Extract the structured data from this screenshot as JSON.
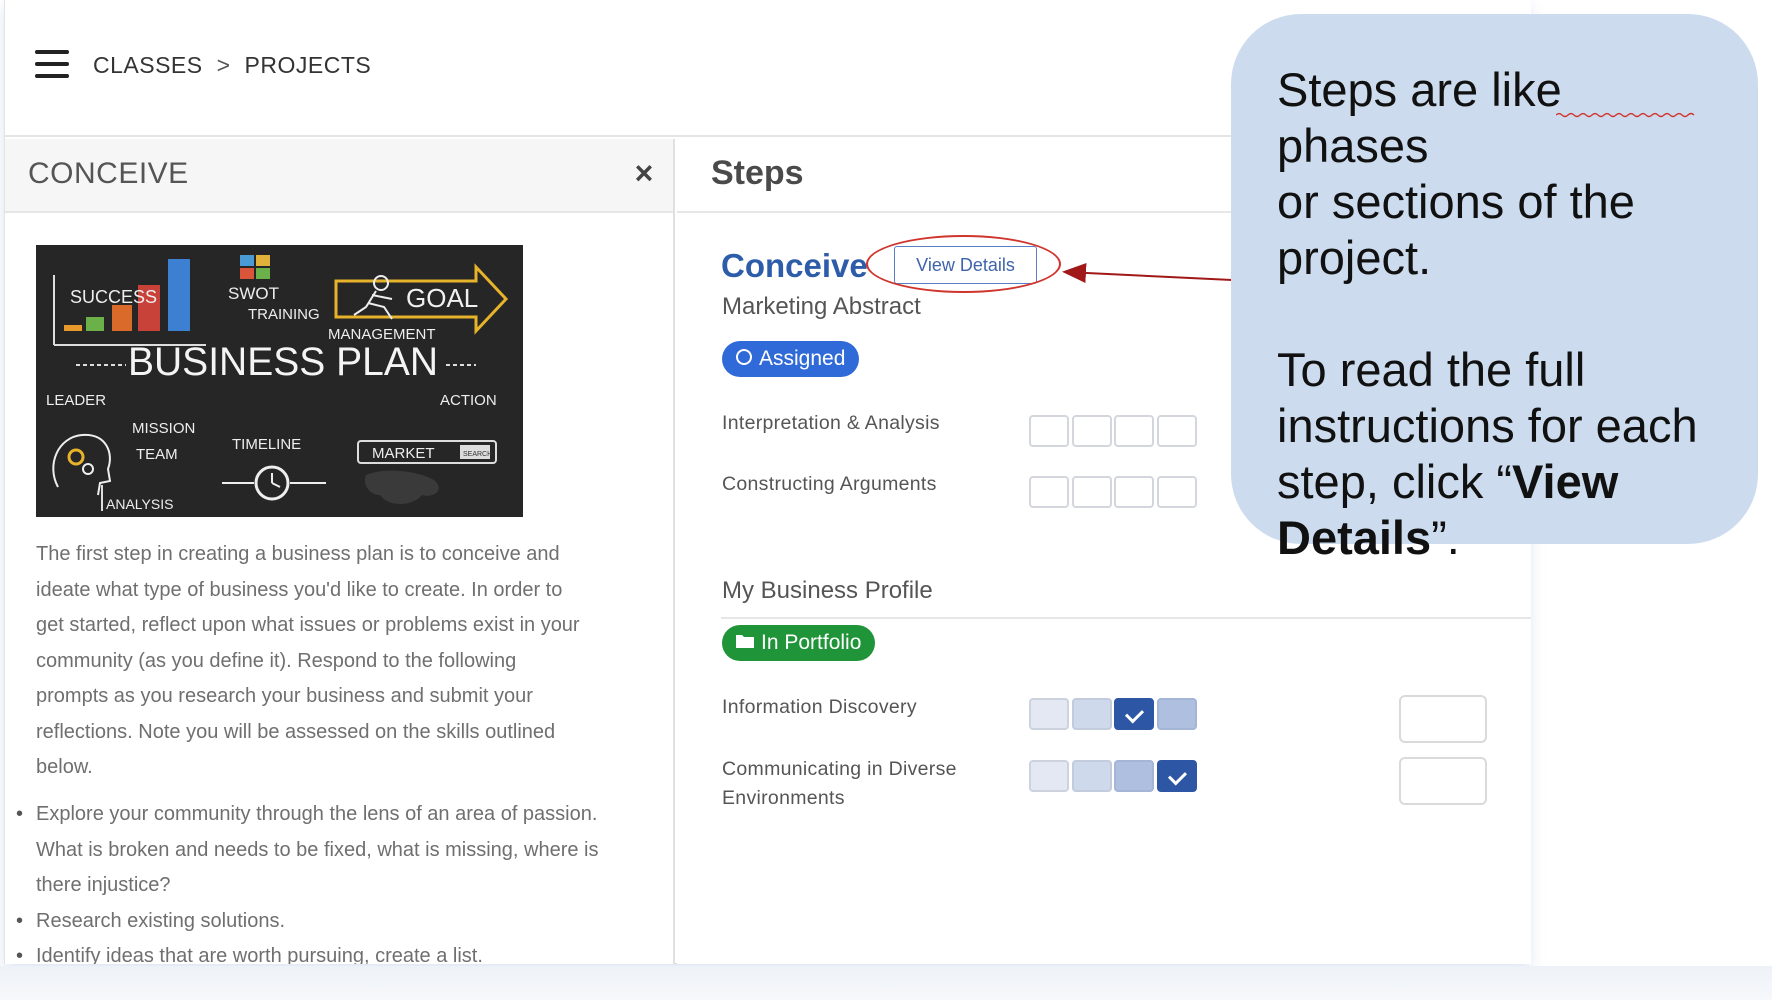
{
  "topbar": {
    "breadcrumb": [
      "CLASSES",
      ">",
      "PROJECTS"
    ]
  },
  "left_panel": {
    "title": "CONCEIVE",
    "close_label": "×",
    "image_labels": {
      "success": "SUCCESS",
      "swot": "SWOT",
      "training": "TRAINING",
      "goal": "GOAL",
      "management": "MANAGEMENT",
      "business_plan": "BUSINESS PLAN",
      "leader": "LEADER",
      "action": "ACTION",
      "mission": "MISSION",
      "team": "TEAM",
      "timeline": "TIMELINE",
      "market": "MARKET",
      "search": "SEARCH",
      "analysis": "ANALYSIS"
    },
    "description": [
      "The first step in creating a business plan is to conceive and",
      "ideate what type of business  you'd like to create. In order to",
      "get started, reflect upon what issues or problems exist in your",
      "community (as you define it). Respond to the following",
      "prompts as you research your business and submit your",
      "reflections. Note you will be assessed on the skills outlined",
      "below."
    ],
    "bullets": [
      [
        "Explore your community through the lens of an area of passion.",
        "What is broken and needs to be fixed, what is missing, where is",
        "there injustice?"
      ],
      [
        "Research existing solutions."
      ],
      [
        "Identify ideas that are worth pursuing, create a list."
      ]
    ]
  },
  "right_panel": {
    "title": "Steps",
    "step_name": "Conceive",
    "view_details_label": "View Details",
    "sections": [
      {
        "title": "Marketing Abstract",
        "badge": "Assigned",
        "badge_color": "#2f6ad8",
        "skills": [
          {
            "name": [
              "Interpretation & Analysis"
            ],
            "levels": [
              0,
              0,
              0,
              0
            ],
            "selected": null
          },
          {
            "name": [
              "Constructing Arguments"
            ],
            "levels": [
              0,
              0,
              0,
              0
            ],
            "selected": null
          }
        ]
      },
      {
        "title": "My Business Profile",
        "badge": "In Portfolio",
        "badge_color": "#1f9438",
        "skills": [
          {
            "name": [
              "Information Discovery"
            ],
            "levels": [
              1,
              2,
              3,
              3
            ],
            "selected": 3
          },
          {
            "name": [
              "Communicating in Diverse",
              "Environments"
            ],
            "levels": [
              1,
              2,
              3,
              3
            ],
            "selected": 4
          }
        ]
      }
    ]
  },
  "callout": {
    "paragraph1": [
      "Steps are like phases",
      "or sections of the",
      "project."
    ],
    "paragraph2_lines": [
      "To read the full",
      "instructions for each"
    ],
    "paragraph2_pre": "step, click “",
    "paragraph2_bold1": "View",
    "paragraph2_bold2": "Details",
    "paragraph2_post": "”."
  },
  "colors": {
    "accent_blue": "#2d5ca8",
    "callout_bg": "#ccdcee",
    "annotation_red": "#d0342c"
  }
}
